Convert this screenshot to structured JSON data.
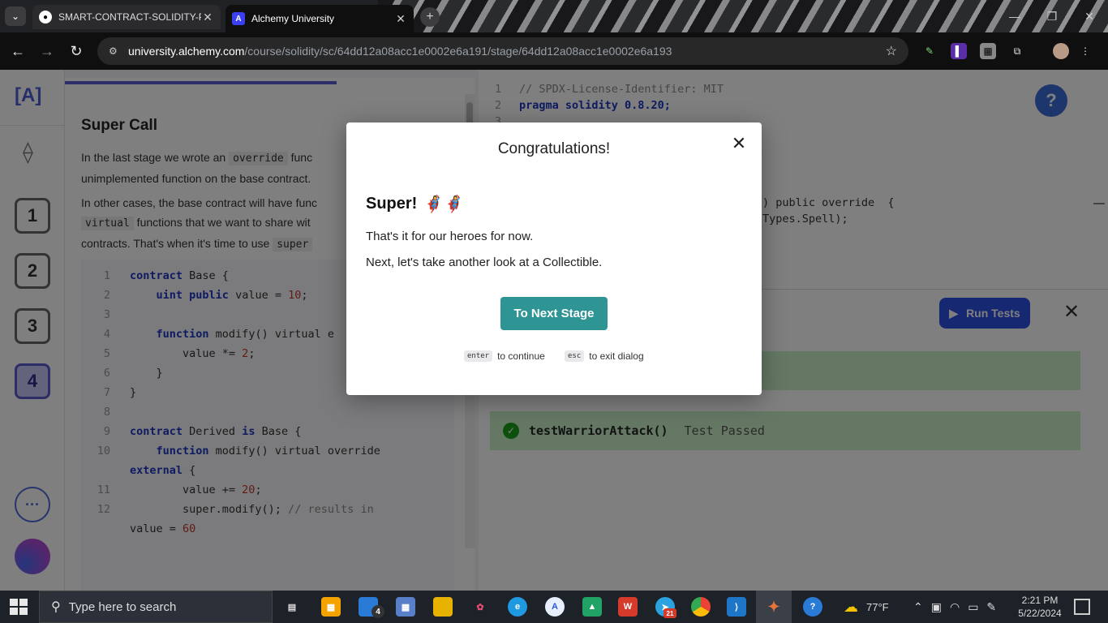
{
  "browser": {
    "tabs": [
      {
        "title": "SMART-CONTRACT-SOLIDITY-P",
        "favicon": "github-icon"
      },
      {
        "title": "Alchemy University",
        "favicon": "alchemy-icon",
        "active": true
      }
    ],
    "url_host": "university.alchemy.com",
    "url_path": "/course/solidity/sc/64dd12a08acc1e0002e6a191/stage/64dd12a08acc1e0002e6a193"
  },
  "rail": {
    "logo": "[A]",
    "stages": [
      "1",
      "2",
      "3",
      "4"
    ],
    "active_stage": "4",
    "more": "···"
  },
  "lesson": {
    "title": "Super Call",
    "p1_a": "In the last stage we wrote an ",
    "p1_code": "override",
    "p1_b": " func",
    "p1_c": "unimplemented function on the base contract.",
    "p2_a": "In other cases, the base contract will have func",
    "p2_code1": "virtual",
    "p2_b": " functions that we want to share wit",
    "p2_c": "contracts. That's when it's time to use ",
    "p2_code2": "super",
    "code_lines": [
      {
        "n": "1",
        "t": "contract Base {"
      },
      {
        "n": "2",
        "t": "    uint public value = 10;"
      },
      {
        "n": "3",
        "t": ""
      },
      {
        "n": "4",
        "t": "    function modify() virtual e"
      },
      {
        "n": "5",
        "t": "        value *= 2;"
      },
      {
        "n": "6",
        "t": "    }"
      },
      {
        "n": "7",
        "t": "}"
      },
      {
        "n": "8",
        "t": ""
      },
      {
        "n": "9",
        "t": "contract Derived is Base {"
      },
      {
        "n": "10",
        "t": "    function modify() virtual override"
      },
      {
        "n": "",
        "t": "external {"
      },
      {
        "n": "11",
        "t": "        value += 20;"
      },
      {
        "n": "12",
        "t": "        super.modify(); // results in"
      },
      {
        "n": "",
        "t": "value = 60"
      }
    ]
  },
  "editor": {
    "line1_n": "1",
    "line1": "// SPDX-License-Identifier: MIT",
    "line2_n": "2",
    "line2": "pragma solidity 0.8.20;",
    "line3_n": "3",
    "frag_a": ") public override  {",
    "frag_b": "Types.Spell);",
    "help": "?"
  },
  "results": {
    "run_label": "Run Tests",
    "tests": [
      {
        "name": "testWarriorAttack()",
        "status": "Test Passed"
      }
    ]
  },
  "modal": {
    "title": "Congratulations!",
    "heading": "Super!",
    "emoji": "🦸‍♀️🦸‍♀️",
    "line1": "That's it for our heroes for now.",
    "line2": "Next, let's take another look at a Collectible.",
    "button": "To Next Stage",
    "hint1_key": "enter",
    "hint1_text": "to continue",
    "hint2_key": "esc",
    "hint2_text": "to exit dialog"
  },
  "taskbar": {
    "search_placeholder": "Type here to search",
    "weather": "77°F",
    "time": "2:21 PM",
    "date": "5/22/2024",
    "badge_mail": "4",
    "badge_telegram": "21"
  }
}
